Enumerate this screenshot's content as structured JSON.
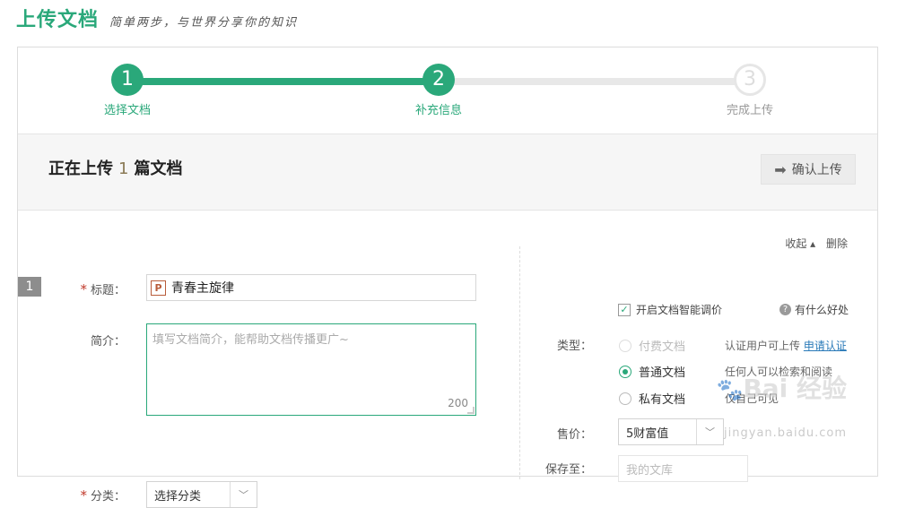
{
  "header": {
    "title": "上传文档",
    "slogan": "简单两步，与世界分享你的知识"
  },
  "steps": [
    {
      "num": "1",
      "label": "选择文档",
      "state": "done"
    },
    {
      "num": "2",
      "label": "补充信息",
      "state": "active"
    },
    {
      "num": "3",
      "label": "完成上传",
      "state": "todo"
    }
  ],
  "band": {
    "prefix": "正在上传",
    "count": "1",
    "suffix": "篇文档",
    "confirm_label": "确认上传"
  },
  "actions": {
    "collapse": "收起 ▴",
    "delete": "删除"
  },
  "form": {
    "index": "1",
    "title_label": "标题：",
    "title_value": "青春主旋律",
    "file_type_letter": "P",
    "intro_label": "简介：",
    "intro_placeholder": "填写文档简介，能帮助文档传播更广~",
    "intro_counter": "200",
    "category_label": "分类：",
    "category_value": "选择分类"
  },
  "right": {
    "type_label": "类型：",
    "types": [
      {
        "label": "付费文档",
        "desc": "认证用户可上传",
        "link": "申请认证",
        "state": "disabled"
      },
      {
        "label": "普通文档",
        "desc": "任何人可以检索和阅读",
        "state": "checked"
      },
      {
        "label": "私有文档",
        "desc": "仅自己可见",
        "state": "unchecked"
      }
    ],
    "price_label": "售价：",
    "price_value": "5财富值",
    "smart_price": "开启文档智能调价",
    "help_text": "有什么好处",
    "save_label": "保存至：",
    "save_value": "我的文库"
  },
  "watermark": {
    "brand": "Bai 经验",
    "url": "jingyan.baidu.com"
  },
  "colors": {
    "accent": "#2aa87a",
    "required": "#c0392b"
  }
}
